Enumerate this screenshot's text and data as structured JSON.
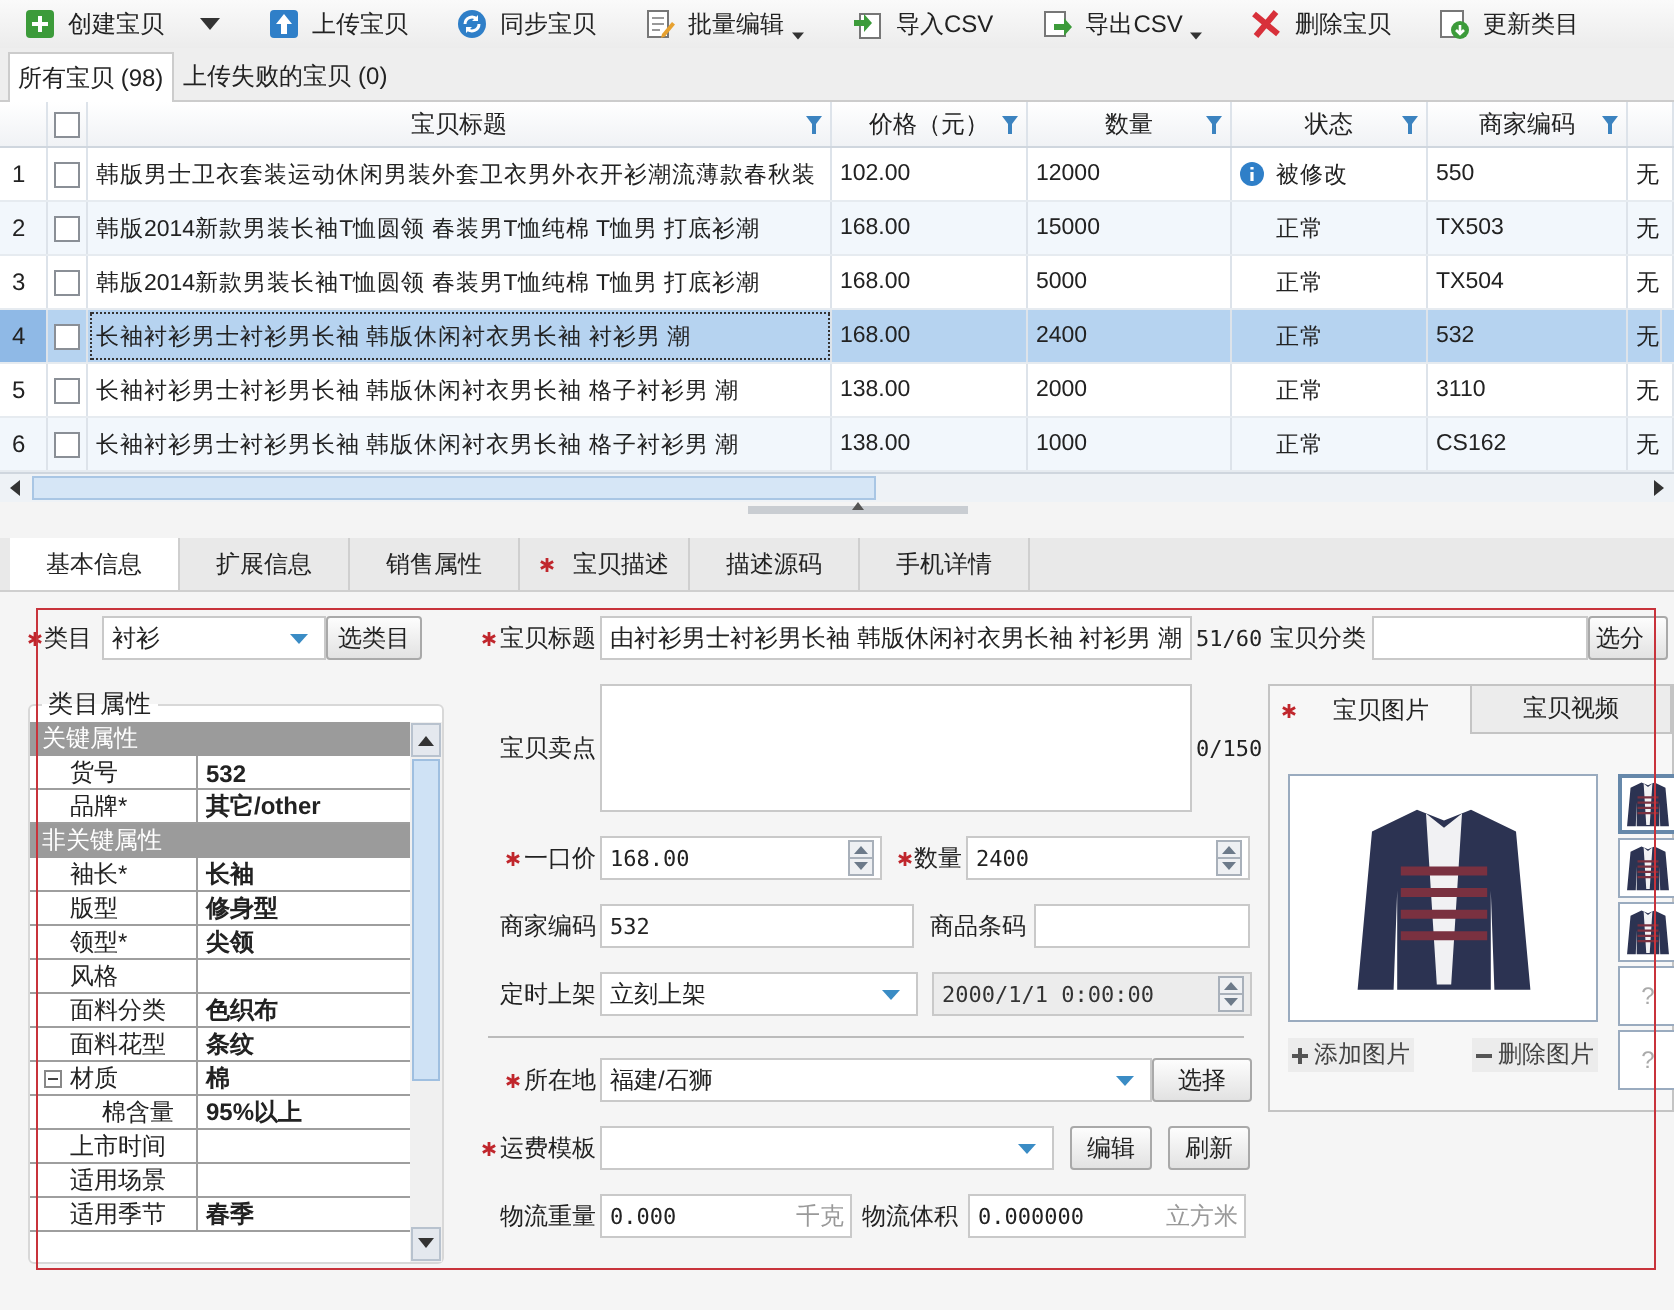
{
  "toolbar": [
    {
      "label": "创建宝贝",
      "dropdown": true
    },
    {
      "label": "上传宝贝",
      "dropdown": false
    },
    {
      "label": "同步宝贝",
      "dropdown": false
    },
    {
      "label": "批量编辑",
      "dropdown": true
    },
    {
      "label": "导入CSV",
      "dropdown": false
    },
    {
      "label": "导出CSV",
      "dropdown": true
    },
    {
      "label": "删除宝贝",
      "dropdown": false
    },
    {
      "label": "更新类目",
      "dropdown": false
    }
  ],
  "list_tabs": [
    {
      "label": "所有宝贝 (98)",
      "selected": true
    },
    {
      "label": "上传失败的宝贝 (0)",
      "selected": false
    }
  ],
  "table": {
    "header_checked": false,
    "columns": [
      "宝贝标题",
      "价格（元）",
      "数量",
      "状态",
      "商家编码"
    ],
    "rows": [
      {
        "number": "1",
        "checked": false,
        "selected": false,
        "title": "韩版男士卫衣套装运动休闲男装外套卫衣男外衣开衫潮流薄款春秋装",
        "price": "102.00",
        "quantity": "12000",
        "status": "被修改",
        "modified": true,
        "merchant_code": "550",
        "column_7": "无"
      },
      {
        "number": "2",
        "checked": false,
        "selected": false,
        "title": "韩版2014新款男装长袖T恤圆领 春装男T恤纯棉 T恤男 打底衫潮",
        "price": "168.00",
        "quantity": "15000",
        "status": "正常",
        "modified": false,
        "merchant_code": "TX503",
        "column_7": "无"
      },
      {
        "number": "3",
        "checked": false,
        "selected": false,
        "title": "韩版2014新款男装长袖T恤圆领 春装男T恤纯棉 T恤男 打底衫潮",
        "price": "168.00",
        "quantity": "5000",
        "status": "正常",
        "modified": false,
        "merchant_code": "TX504",
        "column_7": "无"
      },
      {
        "number": "4",
        "checked": false,
        "selected": true,
        "title": "长袖衬衫男士衬衫男长袖 韩版休闲衬衣男长袖 衬衫男 潮",
        "price": "168.00",
        "quantity": "2400",
        "status": "正常",
        "modified": false,
        "merchant_code": "532",
        "column_7": "无"
      },
      {
        "number": "5",
        "checked": false,
        "selected": false,
        "title": "长袖衬衫男士衬衫男长袖 韩版休闲衬衣男长袖 格子衬衫男 潮",
        "price": "138.00",
        "quantity": "2000",
        "status": "正常",
        "modified": false,
        "merchant_code": "3110",
        "column_7": "无"
      },
      {
        "number": "6",
        "checked": false,
        "selected": false,
        "title": "长袖衬衫男士衬衫男长袖 韩版休闲衬衣男长袖 格子衬衫男 潮",
        "price": "138.00",
        "quantity": "1000",
        "status": "正常",
        "modified": false,
        "merchant_code": "CS162",
        "column_7": "无"
      }
    ]
  },
  "detail_tabs": [
    {
      "label": "基本信息",
      "selected": true,
      "required": false
    },
    {
      "label": "扩展信息",
      "selected": false,
      "required": false
    },
    {
      "label": "销售属性",
      "selected": false,
      "required": false
    },
    {
      "label": "宝贝描述",
      "selected": false,
      "required": true
    },
    {
      "label": "描述源码",
      "selected": false,
      "required": false
    },
    {
      "label": "手机详情",
      "selected": false,
      "required": false
    }
  ],
  "category": {
    "label": "类目",
    "required": true,
    "value": "衬衫",
    "button": "选类目"
  },
  "attributes": {
    "title": "类目属性",
    "groups": [
      {
        "name": "关键属性",
        "properties": [
          {
            "name": "货号",
            "value": "532"
          },
          {
            "name": "品牌*",
            "value": "其它/other"
          }
        ]
      },
      {
        "name": "非关键属性",
        "properties": [
          {
            "name": "袖长*",
            "value": "长袖"
          },
          {
            "name": "版型",
            "value": "修身型"
          },
          {
            "name": "领型*",
            "value": "尖领"
          },
          {
            "name": "风格"
          },
          {
            "name": "面料分类",
            "value": "色织布"
          },
          {
            "name": "面料花型",
            "value": "条纹"
          },
          {
            "name": "材质",
            "value": "棉",
            "expanded": true,
            "children": [
              {
                "name": "棉含量",
                "value": "95%以上"
              }
            ]
          },
          {
            "name": "上市时间"
          },
          {
            "name": "适用场景"
          },
          {
            "name": "适用季节",
            "value": "春季"
          }
        ]
      }
    ]
  },
  "title_field": {
    "label": "宝贝标题",
    "required": true,
    "value": "由衬衫男士衬衫男长袖 韩版休闲衬衣男长袖 衬衫男 潮",
    "counter": "51/60"
  },
  "selling_points": {
    "label": "宝贝卖点",
    "counter": "0/150"
  },
  "price": {
    "label": "一口价",
    "required": true,
    "value": "168.00"
  },
  "quantity": {
    "label": "数量",
    "required": true,
    "value": "2400"
  },
  "merchant_code": {
    "label": "商家编码",
    "value": "532"
  },
  "barcode": {
    "label": "商品条码"
  },
  "listing": {
    "label": "定时上架",
    "value": "立刻上架",
    "datetime": "2000/1/1 0:00:00",
    "datetime_disabled": true
  },
  "location": {
    "label": "所在地",
    "required": true,
    "value": "福建/石狮",
    "button": "选择"
  },
  "shipping_template": {
    "label": "运费模板",
    "required": true,
    "buttons": [
      "编辑",
      "刷新"
    ]
  },
  "weight": {
    "label": "物流重量",
    "value": "0.000",
    "unit": "千克"
  },
  "volume": {
    "label": "物流体积",
    "value": "0.000000",
    "unit": "立方米"
  },
  "shop_category": {
    "label": "宝贝分类",
    "button": "选分"
  },
  "media_tabs": [
    {
      "label": "宝贝图片",
      "selected": true,
      "required": true
    },
    {
      "label": "宝贝视频",
      "selected": false,
      "required": false
    }
  ],
  "thumbnails": [
    {
      "kind": "photo",
      "selected": true
    },
    {
      "kind": "photo",
      "selected": false
    },
    {
      "kind": "photo",
      "selected": false
    },
    {
      "kind": "empty",
      "selected": false,
      "label": "?"
    },
    {
      "kind": "empty",
      "selected": false,
      "label": "?"
    }
  ],
  "image_actions": [
    {
      "kind": "add",
      "label": "添加图片"
    },
    {
      "kind": "remove",
      "label": "删除图片"
    }
  ]
}
